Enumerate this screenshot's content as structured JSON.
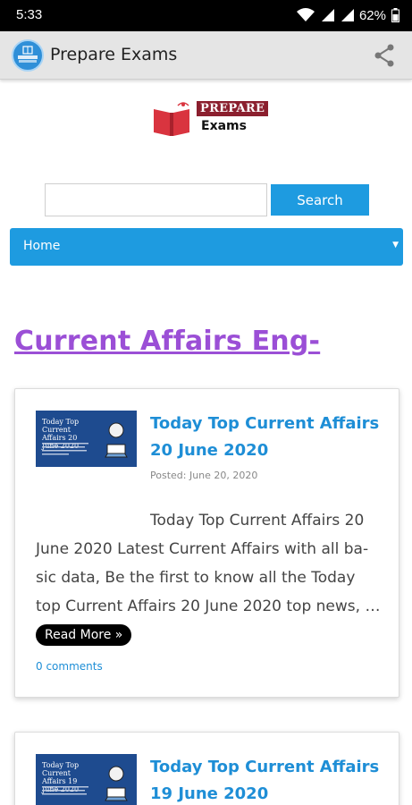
{
  "status_bar": {
    "time": "5:33",
    "battery_pct": "62%"
  },
  "app_bar": {
    "title": "Prepare Exams",
    "logo_text": "PREPARE EXAMS"
  },
  "site": {
    "logo_top": "PREPARE",
    "logo_bottom": "Exams"
  },
  "search": {
    "value": "",
    "placeholder": "",
    "button_label": "Search"
  },
  "nav": {
    "selected": "Home"
  },
  "category": {
    "title": "Current Affairs Eng-"
  },
  "posts": [
    {
      "title": "Today Top Current Affairs 20 June 2020",
      "date": "Posted: June 20, 2020",
      "thumb_title": "Today Top Current Affairs 20 June 2020",
      "excerpt": "Today Top Current Affairs 20 June 2020 Latest Current Affairs with all ba-sic data, Be the first to know all the Today top Current Affairs 20 June 2020 top news, …",
      "read_more": "Read More »",
      "comments": "0 comments"
    },
    {
      "title": "Today Top Current Affairs 19 June 2020",
      "thumb_title": "Today Top Current Affairs 19 June 2020"
    }
  ],
  "colors": {
    "accent": "#1e9be0",
    "category": "#9b4fd6",
    "link": "#1e8ed6",
    "status_bar": "#000000",
    "app_bar": "#e5e5e5"
  },
  "icons": [
    "signal-icon",
    "wifi-icon",
    "battery-icon",
    "share-icon",
    "book-logo-icon",
    "dropdown-caret-icon"
  ]
}
